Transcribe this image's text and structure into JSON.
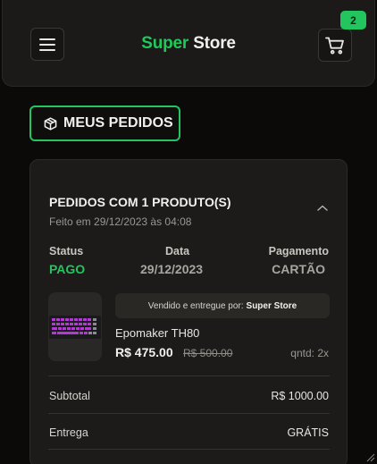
{
  "header": {
    "logo_part1": "Super",
    "logo_part2": "Store",
    "cart_count": "2",
    "menu_icon": "hamburger-menu-icon",
    "cart_icon": "shopping-cart-icon"
  },
  "page": {
    "title": "MEUS PEDIDOS",
    "title_icon": "package-box-icon"
  },
  "order": {
    "title": "PEDIDOS COM 1 PRODUTO(S)",
    "subtitle": "Feito em 29/12/2023 às 04:08",
    "collapse_icon": "chevron-up-icon",
    "status_label": "Status",
    "status_value": "PAGO",
    "date_label": "Data",
    "date_value": "29/12/2023",
    "payment_label": "Pagamento",
    "payment_value": "CARTÃO",
    "item": {
      "seller_prefix": "Vendido e entregue por:",
      "seller_name": "Super Store",
      "name": "Epomaker TH80",
      "price": "R$ 475.00",
      "old_price": "R$ 500.00",
      "qty": "qntd: 2x"
    },
    "subtotal_label": "Subtotal",
    "subtotal_value": "R$ 1000.00",
    "shipping_label": "Entrega",
    "shipping_value": "GRÁTIS"
  },
  "colors": {
    "accent": "#22c55e",
    "background": "#0b0a09",
    "card": "#1c1b19"
  }
}
